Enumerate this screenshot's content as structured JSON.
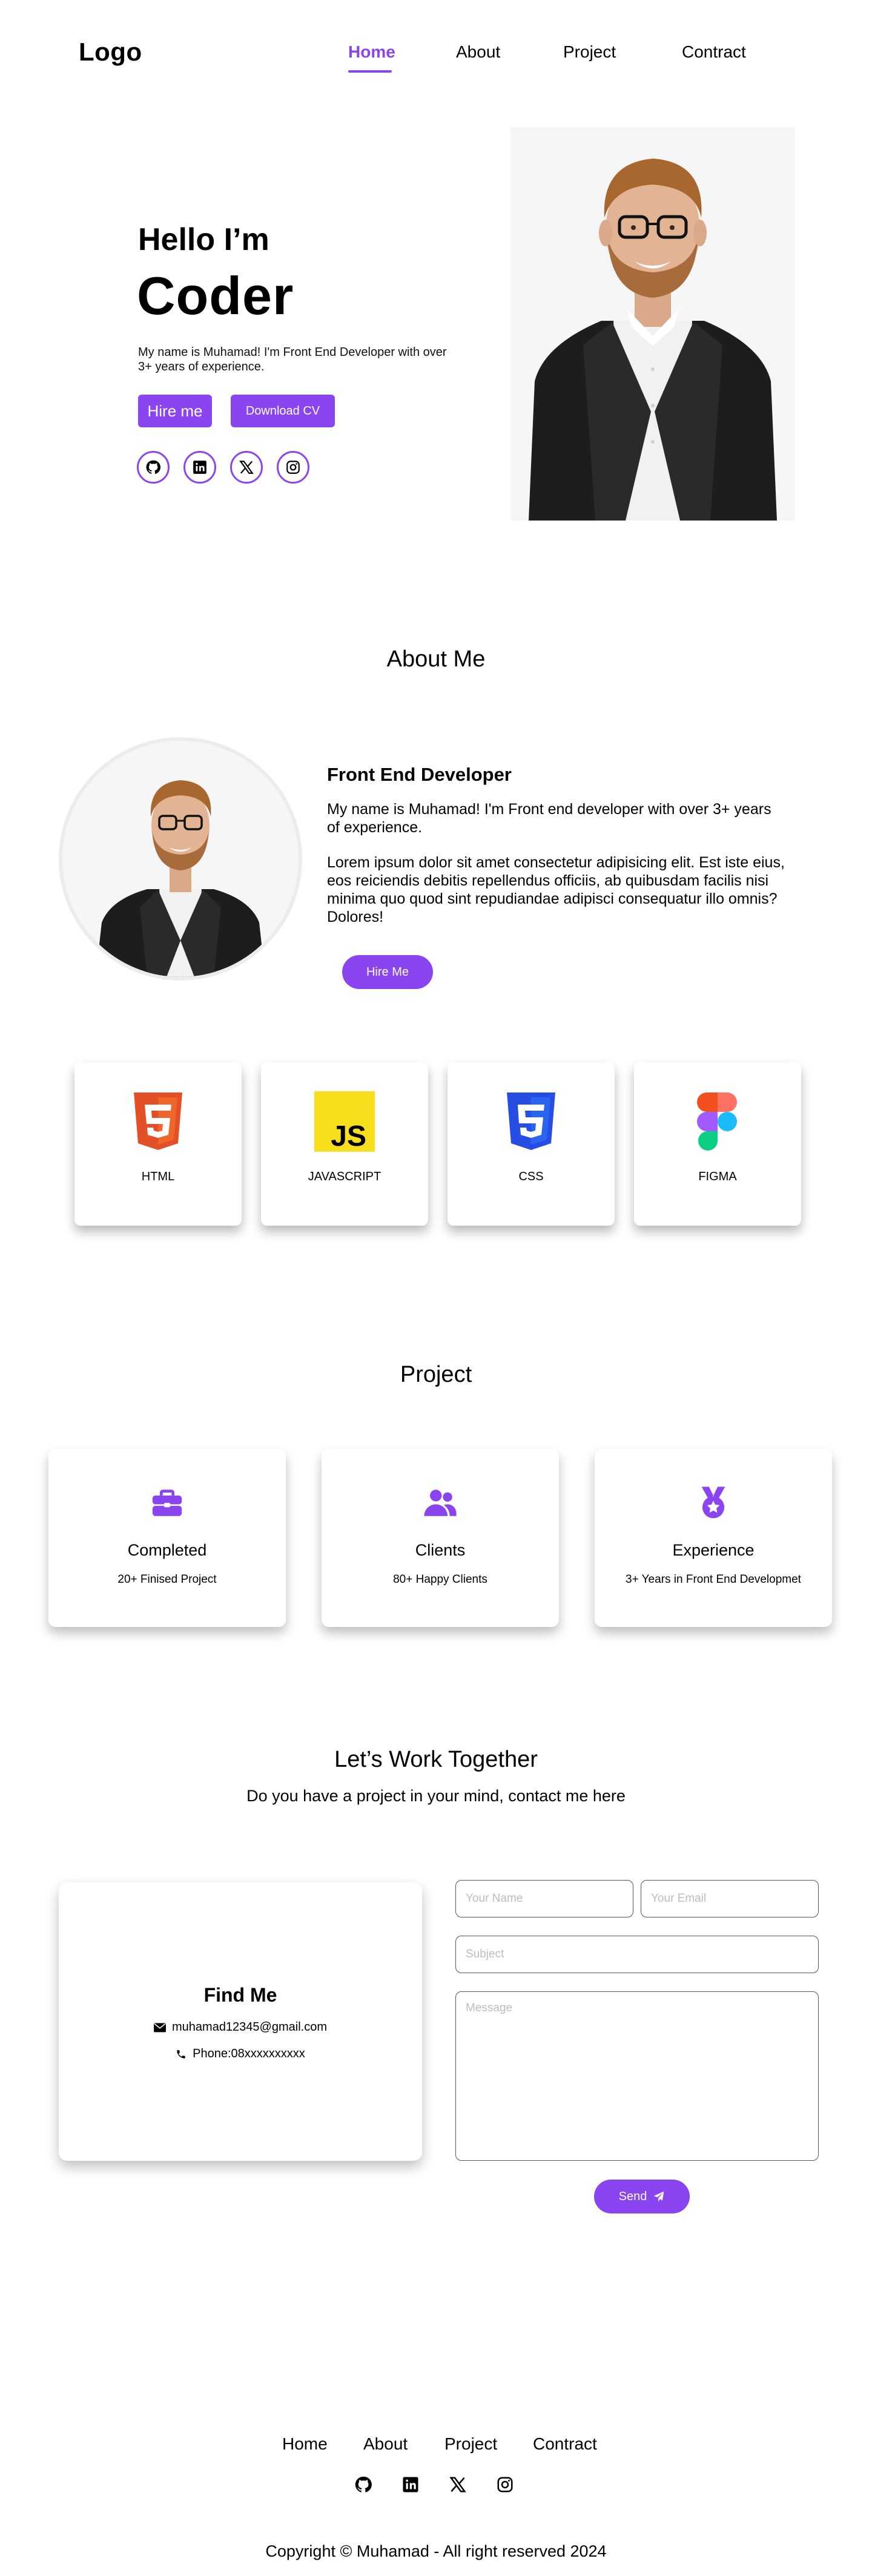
{
  "nav": {
    "logo": "Logo",
    "links": [
      {
        "label": "Home",
        "active": true
      },
      {
        "label": "About",
        "active": false
      },
      {
        "label": "Project",
        "active": false
      },
      {
        "label": "Contract",
        "active": false
      }
    ]
  },
  "hero": {
    "greeting": "Hello I’m",
    "title": "Coder",
    "description": "My name is Muhamad! I'm Front End Developer with over 3+ years of experience.",
    "hire_label": "Hire me",
    "cv_label": "Download CV",
    "socials": [
      "github-icon",
      "linkedin-icon",
      "x-icon",
      "instagram-icon"
    ]
  },
  "about": {
    "heading": "About Me",
    "role": "Front End Developer",
    "paragraph1": "My name is Muhamad! I'm Front end developer with over 3+ years of experience.",
    "paragraph2": "Lorem ipsum dolor sit amet consectetur adipisicing elit. Est iste eius, eos reiciendis debitis repellendus officiis, ab quibusdam facilis nisi minima quo quod sint repudiandae adipisci consequatur illo omnis? Dolores!",
    "hire_label": "Hire Me"
  },
  "skills": [
    {
      "label": "HTML",
      "icon": "html5-icon",
      "color": "#e34f26"
    },
    {
      "label": "JAVASCRIPT",
      "icon": "javascript-icon",
      "color": "#f7df1e"
    },
    {
      "label": "CSS",
      "icon": "css3-icon",
      "color": "#264de4"
    },
    {
      "label": "FIGMA",
      "icon": "figma-icon",
      "color": "#a259ff"
    }
  ],
  "project": {
    "heading": "Project",
    "stats": [
      {
        "title": "Completed",
        "sub": "20+ Finised Project",
        "icon": "briefcase-icon"
      },
      {
        "title": "Clients",
        "sub": "80+ Happy Clients",
        "icon": "users-icon"
      },
      {
        "title": "Experience",
        "sub": "3+ Years in Front End Developmet",
        "icon": "medal-icon"
      }
    ]
  },
  "contact": {
    "heading": "Let’s Work Together",
    "subheading": "Do you have a project in your mind, contact me here",
    "find_title": "Find Me",
    "email": "muhamad12345@gmail.com",
    "phone": "Phone:08xxxxxxxxxx",
    "name_placeholder": "Your Name",
    "email_placeholder": "Your Email",
    "subject_placeholder": "Subject",
    "message_placeholder": "Message",
    "send_label": "Send"
  },
  "footer": {
    "links": [
      "Home",
      "About",
      "Project",
      "Contract"
    ],
    "icons": [
      "github-icon",
      "linkedin-icon",
      "x-icon",
      "instagram-icon"
    ],
    "copyright": "Copyright © Muhamad - All right reserved 2024"
  },
  "colors": {
    "accent": "#8b45f0"
  }
}
